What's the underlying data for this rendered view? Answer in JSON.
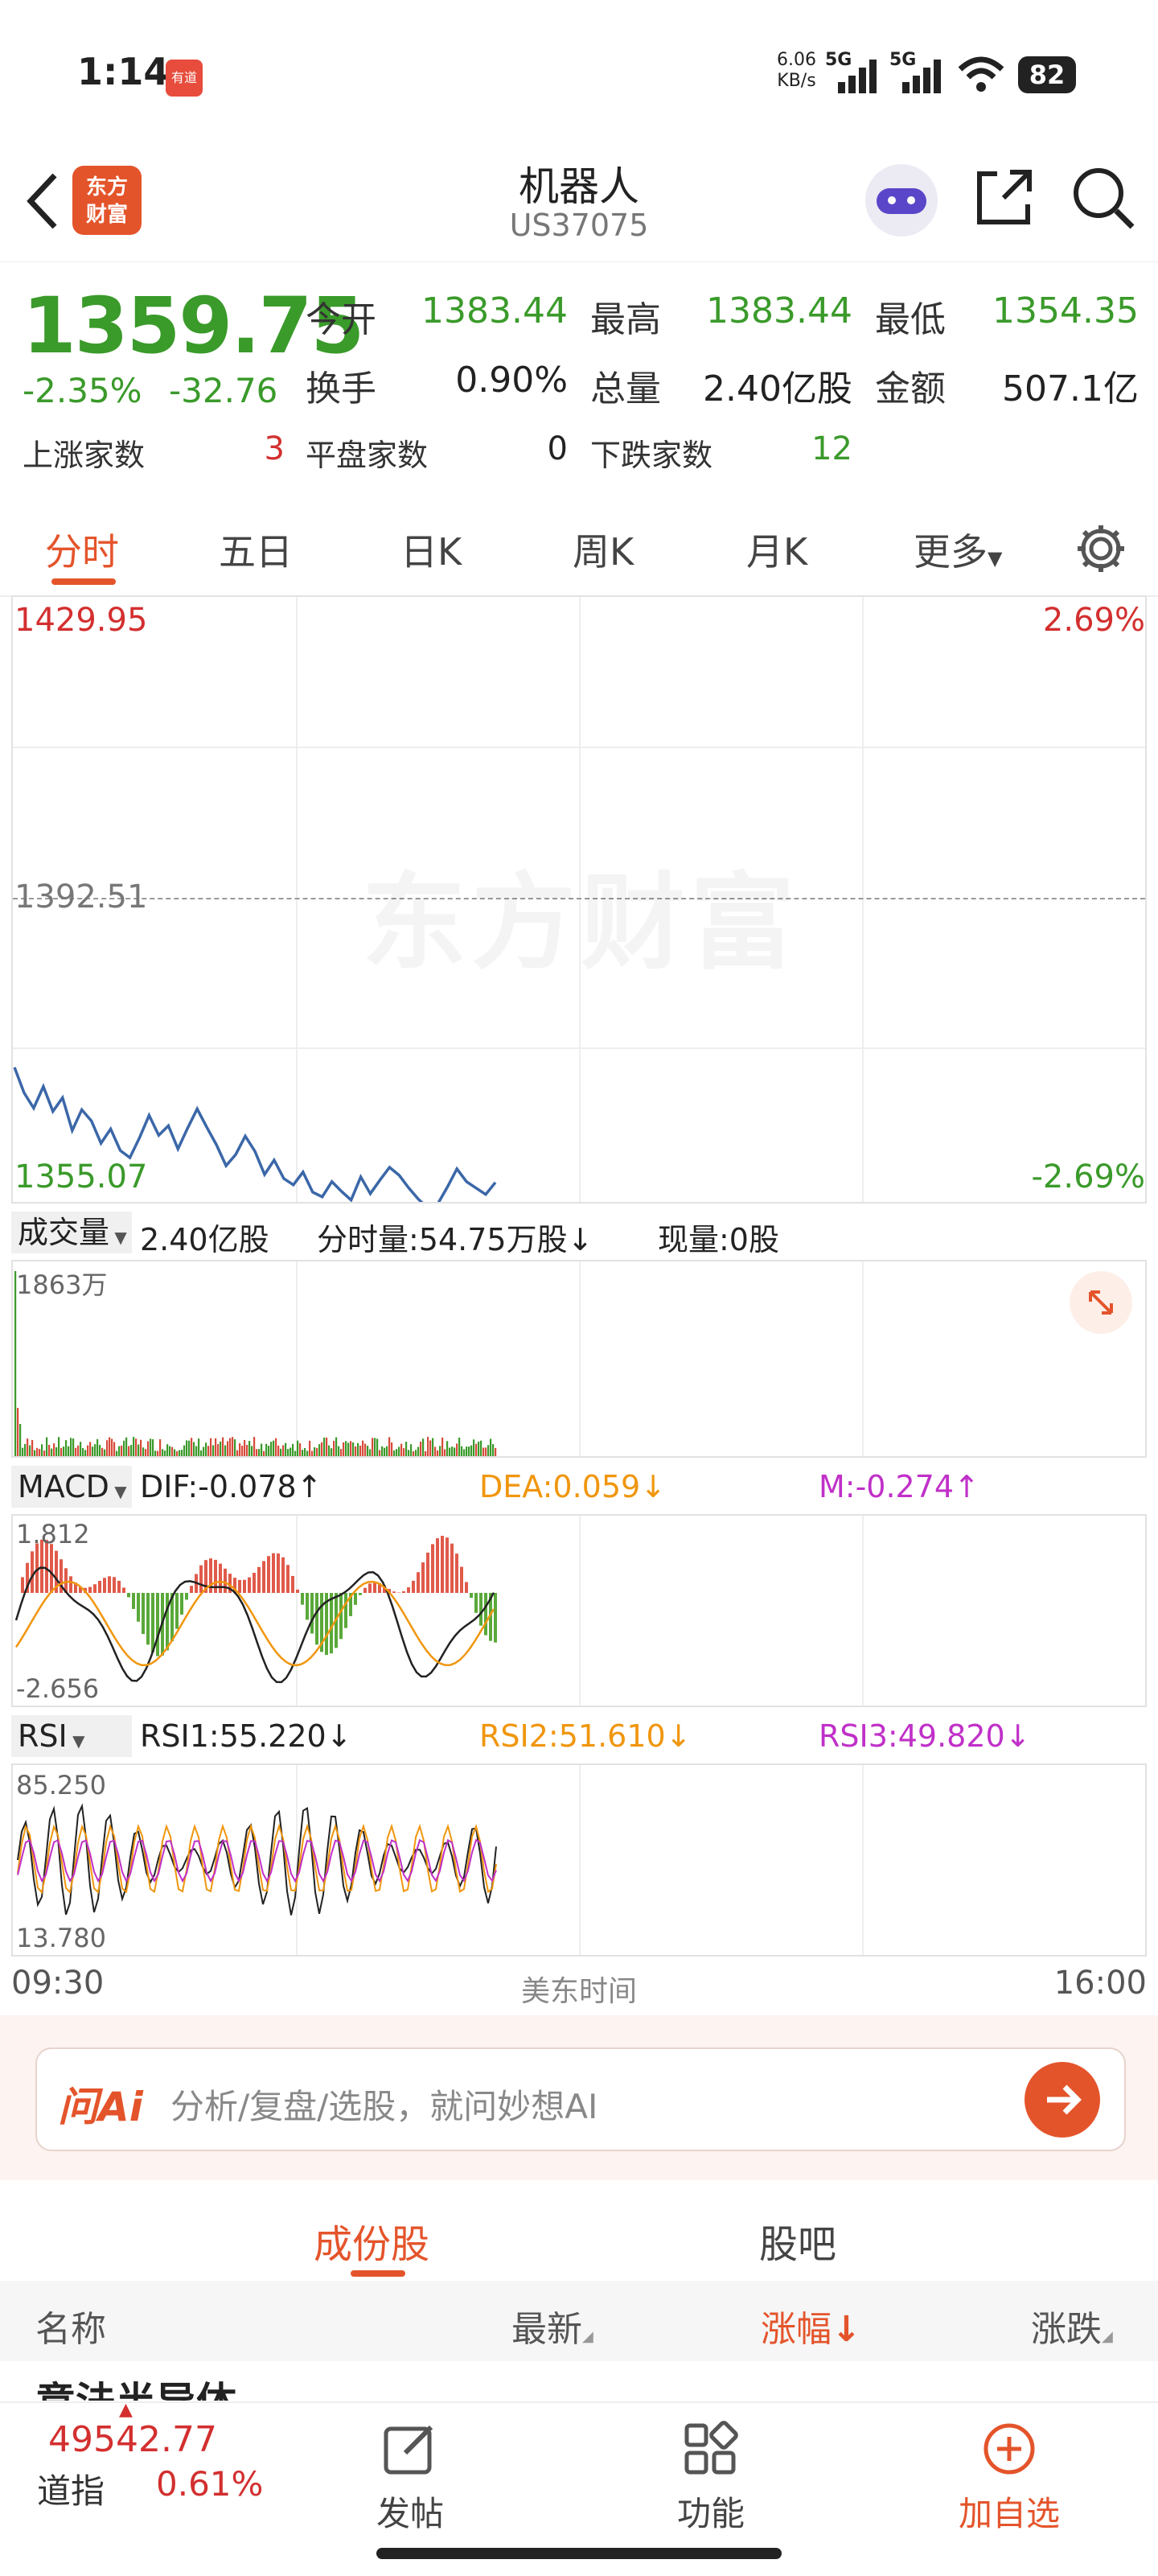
{
  "status": {
    "time": "1:14",
    "app_badge": "有道",
    "net_speed": "6.06",
    "net_unit": "KB/s",
    "sig1": "5G",
    "sig2": "5G",
    "battery": "82"
  },
  "header": {
    "title": "机器人",
    "code": "US37075",
    "logo_top": "东方",
    "logo_bottom": "财富"
  },
  "quote": {
    "price": "1359.75",
    "change_pct": "-2.35%",
    "change": "-32.76",
    "open_label": "今开",
    "open": "1383.44",
    "high_label": "最高",
    "high": "1383.44",
    "low_label": "最低",
    "low": "1354.35",
    "turnover_label": "换手",
    "turnover": "0.90%",
    "volume_label": "总量",
    "volume": "2.40亿股",
    "amount_label": "金额",
    "amount": "507.1亿",
    "up_label": "上涨家数",
    "up": "3",
    "flat_label": "平盘家数",
    "flat": "0",
    "down_label": "下跌家数",
    "down": "12"
  },
  "tabs": [
    "分时",
    "五日",
    "日K",
    "周K",
    "月K",
    "更多"
  ],
  "price_chart": {
    "max": "1429.95",
    "max_pct": "2.69%",
    "mid": "1392.51",
    "min": "1355.07",
    "min_pct": "-2.69%",
    "watermark": "东方财富"
  },
  "volume_panel": {
    "label": "成交量",
    "total": "2.40亿股",
    "minute_vol": "分时量:54.75万股",
    "arrow": "↓",
    "now_vol": "现量:0股",
    "max": "1863万"
  },
  "macd_panel": {
    "label": "MACD",
    "dif": "DIF:-0.078",
    "dif_arrow": "↑",
    "dea": "DEA:0.059",
    "dea_arrow": "↓",
    "m": "M:-0.274",
    "m_arrow": "↑",
    "max": "1.812",
    "min": "-2.656"
  },
  "rsi_panel": {
    "label": "RSI",
    "rsi1": "RSI1:55.220",
    "rsi1_arrow": "↓",
    "rsi2": "RSI2:51.610",
    "rsi2_arrow": "↓",
    "rsi3": "RSI3:49.820",
    "rsi3_arrow": "↓",
    "max": "85.250",
    "min": "13.780"
  },
  "time_axis": {
    "start": "09:30",
    "mid": "美东时间",
    "end": "16:00"
  },
  "ai": {
    "logo": "问Ai",
    "placeholder": "分析/复盘/选股，就问妙想AI"
  },
  "subtabs": [
    "成份股",
    "股吧"
  ],
  "list_header": {
    "name": "名称",
    "latest": "最新",
    "change_pct": "涨幅",
    "change": "涨跌"
  },
  "list_partial": "意法半导体",
  "bottom": {
    "index_value": "49542.77",
    "index_name": "道指",
    "index_pct": "0.61%",
    "post": "发帖",
    "func": "功能",
    "add": "加自选"
  },
  "colors": {
    "up": "#d32f2f",
    "down": "#3a9a2a",
    "accent": "#e4542b",
    "line": "#3b67a8"
  },
  "chart_data": {
    "type": "line",
    "title": "",
    "ylim": [
      1355.07,
      1429.95
    ],
    "prev_close": 1392.51,
    "x_range": [
      "09:30",
      "16:00"
    ],
    "series": [
      {
        "values": [
          1371.5,
          1368.3,
          1366.4,
          1369.1,
          1366.0,
          1367.7,
          1363.6,
          1366.2,
          1364.8,
          1362.0,
          1363.8,
          1361.1,
          1360.2,
          1362.7,
          1365.5,
          1363.0,
          1364.2,
          1361.3,
          1363.9,
          1366.3,
          1364.0,
          1361.8,
          1359.2,
          1360.6,
          1362.9,
          1361.0,
          1358.1,
          1359.9,
          1357.6,
          1356.8,
          1358.4,
          1355.9,
          1355.3,
          1357.2,
          1356.0,
          1354.9,
          1357.8,
          1355.7,
          1357.4,
          1359.0,
          1358.0,
          1356.4,
          1355.0,
          1353.9,
          1354.4,
          1356.5,
          1358.8,
          1357.2,
          1356.4,
          1355.6,
          1357.1
        ]
      }
    ]
  }
}
